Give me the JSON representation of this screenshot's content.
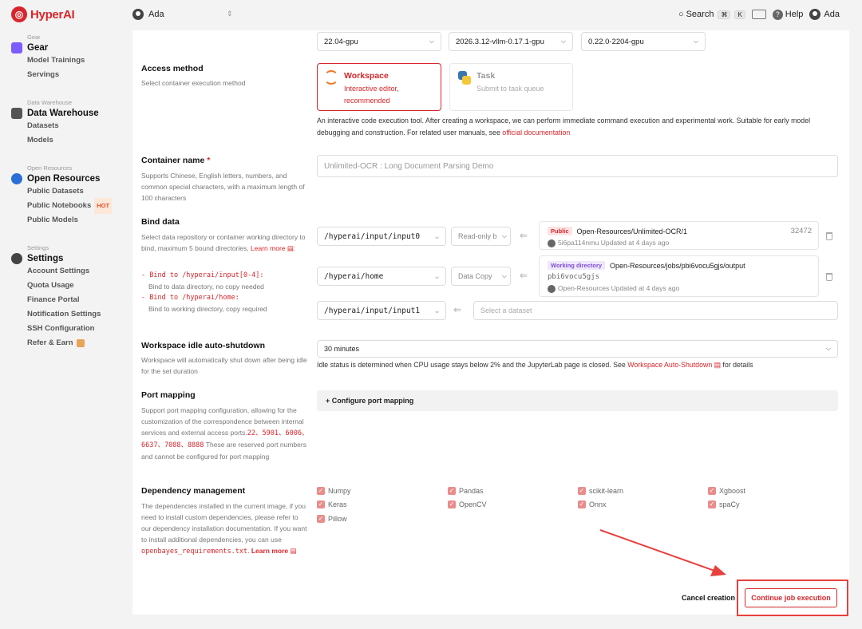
{
  "app": {
    "brand": "HyperAI"
  },
  "topbar": {
    "user": "Ada",
    "search_label": "Search",
    "shortcut_keys": [
      "⌘",
      "K"
    ],
    "help_label": "Help",
    "account_name": "Ada"
  },
  "sidebar": {
    "groups": [
      {
        "caption": "Gear",
        "title": "Gear",
        "icon": "gear-box-icon",
        "color": "#7c5cff",
        "items": [
          "Model Trainings",
          "Servings"
        ]
      },
      {
        "caption": "Data Warehouse",
        "title": "Data Warehouse",
        "icon": "warehouse-icon",
        "color": "#555555",
        "items": [
          "Datasets",
          "Models"
        ]
      },
      {
        "caption": "Open Resources",
        "title": "Open Resources",
        "icon": "open-resources-icon",
        "color": "#2b6fd6",
        "items": [
          "Public Datasets",
          "Public Notebooks",
          "Public Models"
        ],
        "hot_badge": "HOT"
      },
      {
        "caption": "Settings",
        "title": "Settings",
        "icon": "settings-gear-icon",
        "color": "#444444",
        "items": [
          "Account Settings",
          "Quota Usage",
          "Finance Portal",
          "Notification Settings",
          "SSH Configuration",
          "Refer & Earn"
        ]
      }
    ]
  },
  "form": {
    "image_selects": [
      "22.04-gpu",
      "2026.3.12-vllm-0.17.1-gpu",
      "0.22.0-2204-gpu"
    ],
    "access": {
      "title": "Access method",
      "desc": "Select container execution method",
      "workspace_title": "Workspace",
      "workspace_desc": "Interactive editor, recommended",
      "task_title": "Task",
      "task_desc": "Submit to task queue",
      "note": "An interactive code execution tool. After creating a workspace, we can perform immediate command execution and experimental work. Suitable for early model debugging and construction. For related user manuals, see",
      "note_link": "official documentation"
    },
    "container": {
      "title": "Container name",
      "required": "*",
      "desc": "Supports Chinese, English letters, numbers, and common special characters, with a maximum length of 100 characters",
      "value": "Unlimited-OCR : Long Document Parsing Demo"
    },
    "bind": {
      "title": "Bind data",
      "desc": "Select data repository or container working directory to bind, maximum 5 bound directories,",
      "learn_more": "Learn more",
      "hint1_path": "Bind to /hyperai/input[0-4]:",
      "hint1_desc": "Bind to data directory, no copy needed",
      "hint2_path": "Bind to /hyperai/home:",
      "hint2_desc": "Bind to working directory, copy required",
      "rows": [
        {
          "path": "/hyperai/input/input0",
          "mode": "Read-only b"
        },
        {
          "path": "/hyperai/home",
          "mode": "Data Copy"
        },
        {
          "path": "/hyperai/input/input1",
          "placeholder": "Select a dataset"
        }
      ],
      "card1": {
        "badge": "Public",
        "name": "Open-Resources/Unlimited-OCR/1",
        "size": "32472",
        "owner": "5i6pa114nrnu",
        "updated": "Updated at 4 days ago"
      },
      "card2": {
        "badge": "Working directory",
        "name": "Open-Resources/jobs/pbi6vocu5gjs/output",
        "id": "pbi6vocu5gjs",
        "owner": "Open-Resources",
        "updated": "Updated at 4 days ago"
      }
    },
    "idle": {
      "title": "Workspace idle auto-shutdown",
      "desc": "Workspace will automatically shut down after being idle for the set duration",
      "value": "30 minutes",
      "note": "Idle status is determined when CPU usage stays below 2% and the JupyterLab page is closed. See",
      "note_link": "Workspace Auto-Shutdown",
      "note_tail": "for details"
    },
    "port": {
      "title": "Port mapping",
      "desc": "Support port mapping configuration, allowing for the customization of the correspondence between internal services and external access ports.",
      "ports": "22、5901、6006、6637、7088、8888",
      "desc_tail": "These are reserved port numbers and cannot be configured for port mapping",
      "button": "+ Configure port mapping"
    },
    "deps": {
      "title": "Dependency management",
      "desc": "The dependencies installed in the current image, if you need to install custom dependencies, please refer to our dependency installation documentation. If you want to install additional dependencies, you can use",
      "file": "openbayes_requirements.txt",
      "learn_more": "Learn more",
      "items": [
        "Numpy",
        "Pandas",
        "scikit-learn",
        "Xgboost",
        "Keras",
        "OpenCV",
        "Onnx",
        "spaCy",
        "Pillow"
      ]
    },
    "actions": {
      "cancel": "Cancel creation",
      "continue": "Continue job execution"
    }
  },
  "colors": {
    "brand": "#d7262b",
    "annotation": "#e8403d"
  }
}
